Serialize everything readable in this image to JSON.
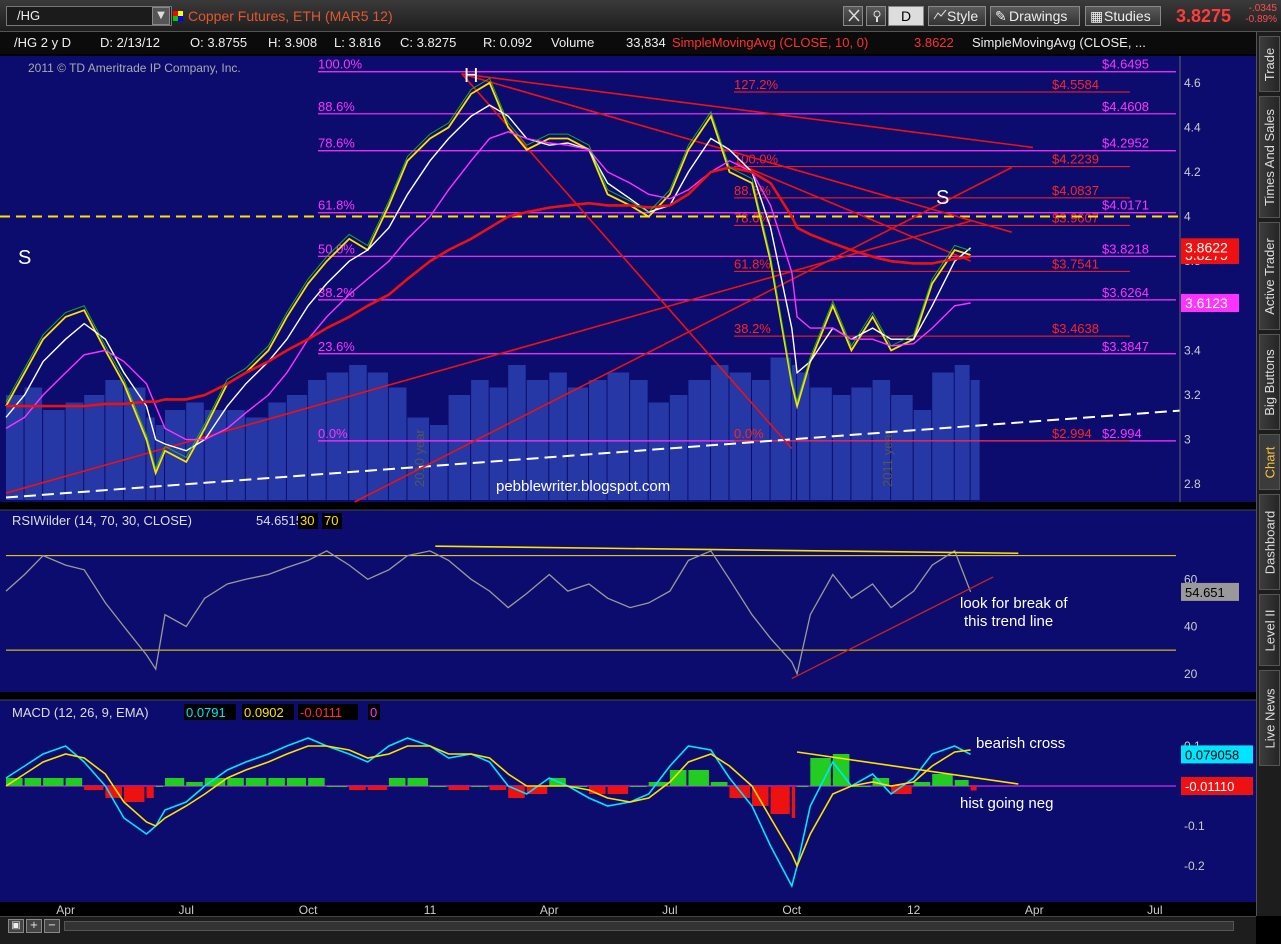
{
  "toolbar": {
    "symbol": "/HG",
    "title": "Copper Futures, ETH (MAR5 12)",
    "timeframe": "D",
    "style_label": "Style",
    "drawings_label": "Drawings",
    "studies_label": "Studies",
    "last_price": "3.8275",
    "change_abs": "-.0345",
    "change_pct": "-0.89%",
    "accent": "#ff3b3b"
  },
  "info_bar": {
    "symbol": "/HG 2 y D",
    "date": "D: 2/13/12",
    "open": "O: 3.8755",
    "high": "H: 3.908",
    "low": "L: 3.816",
    "close": "C: 3.8275",
    "range": "R: 0.092",
    "volume_label": "Volume",
    "volume": "33,834",
    "sma1": "SimpleMovingAvg (CLOSE, 10, 0)",
    "sma1_value": "3.8622",
    "sma2": "SimpleMovingAvg (CLOSE, ..."
  },
  "copyright": "2011 © TD Ameritrade IP Company, Inc.",
  "watermark": "pebblewriter.blogspot.com",
  "sidebar_tabs": [
    "Trade",
    "Times And Sales",
    "Active Trader",
    "Big Buttons",
    "Chart",
    "Dashboard",
    "Level II",
    "Live News"
  ],
  "chart_data": [
    {
      "type": "line",
      "title": "",
      "instrument": "/HG Copper Futures daily (approx.)",
      "x": [
        "2010-02-15",
        "2010-03-01",
        "2010-03-15",
        "2010-04-01",
        "2010-04-15",
        "2010-05-01",
        "2010-05-15",
        "2010-06-01",
        "2010-06-08",
        "2010-06-15",
        "2010-07-01",
        "2010-07-15",
        "2010-08-01",
        "2010-08-15",
        "2010-09-01",
        "2010-09-15",
        "2010-10-01",
        "2010-10-15",
        "2010-11-01",
        "2010-11-15",
        "2010-12-01",
        "2010-12-15",
        "2011-01-01",
        "2011-01-15",
        "2011-02-01",
        "2011-02-15",
        "2011-03-01",
        "2011-03-15",
        "2011-04-01",
        "2011-04-15",
        "2011-05-01",
        "2011-05-15",
        "2011-06-01",
        "2011-06-15",
        "2011-07-01",
        "2011-07-15",
        "2011-08-01",
        "2011-08-15",
        "2011-09-01",
        "2011-09-15",
        "2011-10-01",
        "2011-10-05",
        "2011-10-15",
        "2011-11-01",
        "2011-11-15",
        "2011-12-01",
        "2011-12-15",
        "2012-01-01",
        "2012-01-15",
        "2012-02-01",
        "2012-02-13"
      ],
      "series": [
        {
          "color": "#ffe000",
          "values": [
            3.15,
            3.3,
            3.45,
            3.55,
            3.58,
            3.4,
            3.25,
            3.0,
            2.85,
            2.95,
            2.9,
            3.05,
            3.25,
            3.3,
            3.4,
            3.55,
            3.7,
            3.8,
            3.9,
            3.85,
            4.05,
            4.25,
            4.35,
            4.4,
            4.55,
            4.6,
            4.4,
            4.3,
            4.35,
            4.35,
            4.3,
            4.1,
            4.05,
            4.0,
            4.1,
            4.3,
            4.45,
            4.2,
            4.15,
            3.8,
            3.25,
            3.15,
            3.35,
            3.6,
            3.4,
            3.55,
            3.4,
            3.45,
            3.7,
            3.85,
            3.8275
          ]
        },
        {
          "color": "#ffffff",
          "values": [
            3.1,
            3.2,
            3.35,
            3.45,
            3.52,
            3.45,
            3.3,
            3.15,
            3.0,
            2.98,
            2.95,
            3.0,
            3.15,
            3.25,
            3.35,
            3.45,
            3.6,
            3.7,
            3.8,
            3.85,
            3.95,
            4.1,
            4.25,
            4.35,
            4.45,
            4.5,
            4.45,
            4.35,
            4.32,
            4.33,
            4.3,
            4.15,
            4.08,
            4.02,
            4.05,
            4.2,
            4.35,
            4.3,
            4.2,
            3.95,
            3.5,
            3.3,
            3.35,
            3.5,
            3.45,
            3.5,
            3.45,
            3.45,
            3.6,
            3.8,
            3.86
          ]
        },
        {
          "color": "#ff33ff",
          "values": [
            3.05,
            3.1,
            3.2,
            3.3,
            3.38,
            3.4,
            3.35,
            3.25,
            3.15,
            3.05,
            3.0,
            3.0,
            3.05,
            3.12,
            3.2,
            3.3,
            3.45,
            3.55,
            3.65,
            3.72,
            3.8,
            3.9,
            4.0,
            4.12,
            4.25,
            4.35,
            4.38,
            4.35,
            4.33,
            4.32,
            4.3,
            4.2,
            4.15,
            4.1,
            4.08,
            4.12,
            4.2,
            4.25,
            4.2,
            4.05,
            3.75,
            3.55,
            3.5,
            3.5,
            3.45,
            3.45,
            3.42,
            3.43,
            3.5,
            3.6,
            3.6123
          ]
        },
        {
          "color": "#ee1111",
          "values": [
            3.15,
            3.15,
            3.15,
            3.15,
            3.15,
            3.16,
            3.16,
            3.17,
            3.17,
            3.18,
            3.18,
            3.2,
            3.25,
            3.3,
            3.35,
            3.4,
            3.45,
            3.5,
            3.55,
            3.6,
            3.65,
            3.72,
            3.8,
            3.85,
            3.9,
            3.95,
            4.0,
            4.02,
            4.04,
            4.05,
            4.06,
            4.05,
            4.05,
            4.04,
            4.05,
            4.1,
            4.2,
            4.22,
            4.2,
            4.15,
            4.0,
            3.95,
            3.92,
            3.88,
            3.85,
            3.82,
            3.8,
            3.79,
            3.79,
            3.81,
            3.82
          ]
        }
      ],
      "volume": [
        0.7,
        0.75,
        0.6,
        0.65,
        0.7,
        0.8,
        0.75,
        0.55,
        0.5,
        0.6,
        0.65,
        0.6,
        0.6,
        0.55,
        0.65,
        0.7,
        0.8,
        0.85,
        0.9,
        0.85,
        0.75,
        0.55,
        0.5,
        0.7,
        0.8,
        0.75,
        0.9,
        0.8,
        0.85,
        0.75,
        0.8,
        0.85,
        0.8,
        0.65,
        0.7,
        0.8,
        0.9,
        0.85,
        0.8,
        0.95,
        0.9,
        0.85,
        0.75,
        0.7,
        0.75,
        0.8,
        0.7,
        0.6,
        0.85,
        0.9,
        0.8
      ],
      "ylim": [
        2.72,
        4.72
      ],
      "y_ticks": [
        "4.6",
        "4.4",
        "4.2",
        "4",
        "3.8",
        "3.6",
        "3.4",
        "3.2",
        "3",
        "2.8"
      ],
      "x_ticks": [
        "Apr",
        "Jul",
        "Oct",
        "11",
        "Apr",
        "Jul",
        "Oct",
        "12",
        "Apr",
        "Jul"
      ],
      "x_tick_dates": [
        "2010-04-01",
        "2010-07-01",
        "2010-10-01",
        "2011-01-01",
        "2011-04-01",
        "2011-07-01",
        "2011-10-01",
        "2012-01-01",
        "2012-04-01",
        "2012-07-01"
      ],
      "year_labels": [
        "2010 year",
        "2011 year"
      ],
      "fib_set_1": {
        "color": "#ff33ff",
        "levels": [
          {
            "pct": "100.0%",
            "price": 4.6495,
            "label": "$4.6495"
          },
          {
            "pct": "88.6%",
            "price": 4.4608,
            "label": "$4.4608"
          },
          {
            "pct": "78.6%",
            "price": 4.2952,
            "label": "$4.2952"
          },
          {
            "pct": "61.8%",
            "price": 4.0171,
            "label": "$4.0171"
          },
          {
            "pct": "50.0%",
            "price": 3.8218,
            "label": "$3.8218"
          },
          {
            "pct": "38.2%",
            "price": 3.6264,
            "label": "$3.6264"
          },
          {
            "pct": "23.6%",
            "price": 3.3847,
            "label": "$3.3847"
          },
          {
            "pct": "0.0%",
            "price": 2.994,
            "label": "$2.994"
          }
        ]
      },
      "fib_set_2": {
        "color": "#ff2222",
        "levels": [
          {
            "pct": "127.2%",
            "price": 4.5584,
            "label": "$4.5584"
          },
          {
            "pct": "100.0%",
            "price": 4.2239,
            "label": "$4.2239"
          },
          {
            "pct": "88.6%",
            "price": 4.0837,
            "label": "$4.0837"
          },
          {
            "pct": "78.6%",
            "price": 3.9607,
            "label": "$3.9607"
          },
          {
            "pct": "61.8%",
            "price": 3.7541,
            "label": "$3.7541"
          },
          {
            "pct": "38.2%",
            "price": 3.4638,
            "label": "$3.4638"
          },
          {
            "pct": "0.0%",
            "price": 2.994,
            "label": "$2.994"
          }
        ]
      },
      "pattern_labels": [
        "S",
        "H",
        "S"
      ],
      "price_badges": [
        {
          "label": "3.8275",
          "price": 3.8275,
          "color": "#ee1111"
        },
        {
          "label": "3.8622",
          "price": 3.8622,
          "color": "#ee1111"
        },
        {
          "label": "3.6123",
          "price": 3.6123,
          "color": "#ff33ff"
        }
      ],
      "dashed_yellow_level": 4.0
    },
    {
      "type": "line",
      "title": "RSIWilder (14, 70, 30, CLOSE)",
      "title_value": "54.6515",
      "title_extra": [
        "30",
        "70"
      ],
      "ylim": [
        14,
        80
      ],
      "y_ticks": [
        "60",
        "40",
        "20"
      ],
      "overbought": 70,
      "oversold": 30,
      "values": [
        55,
        62,
        70,
        66,
        64,
        50,
        40,
        28,
        22,
        45,
        40,
        52,
        58,
        60,
        62,
        65,
        68,
        72,
        66,
        60,
        64,
        70,
        72,
        68,
        60,
        55,
        48,
        54,
        62,
        55,
        58,
        52,
        48,
        50,
        55,
        68,
        72,
        60,
        45,
        35,
        25,
        20,
        45,
        62,
        52,
        58,
        48,
        55,
        66,
        72,
        54.65
      ],
      "last_label": "54.651",
      "annotation": [
        "look for break of",
        "this trend line"
      ]
    },
    {
      "type": "line",
      "title": "MACD (12, 26, 9, EMA)",
      "title_values": [
        "0.0791",
        "0.0902",
        "-0.0111",
        "0"
      ],
      "ylim": [
        -0.28,
        0.16
      ],
      "y_ticks": [
        "0.1",
        "0",
        "-0.1",
        "-0.2"
      ],
      "macd": [
        0.02,
        0.05,
        0.08,
        0.1,
        0.06,
        0.0,
        -0.08,
        -0.12,
        -0.1,
        -0.06,
        -0.04,
        0.0,
        0.04,
        0.06,
        0.08,
        0.1,
        0.12,
        0.1,
        0.08,
        0.06,
        0.1,
        0.12,
        0.1,
        0.07,
        0.08,
        0.06,
        0.0,
        -0.02,
        0.02,
        0.0,
        -0.03,
        -0.05,
        -0.04,
        -0.02,
        0.05,
        0.1,
        0.09,
        0.02,
        -0.05,
        -0.15,
        -0.25,
        -0.2,
        -0.05,
        0.06,
        0.0,
        0.03,
        -0.02,
        0.02,
        0.08,
        0.1,
        0.0791
      ],
      "signal": [
        0.0,
        0.03,
        0.06,
        0.08,
        0.07,
        0.03,
        -0.04,
        -0.09,
        -0.1,
        -0.08,
        -0.05,
        -0.02,
        0.02,
        0.04,
        0.06,
        0.08,
        0.1,
        0.1,
        0.09,
        0.07,
        0.08,
        0.1,
        0.1,
        0.08,
        0.08,
        0.07,
        0.03,
        0.0,
        0.0,
        0.0,
        -0.01,
        -0.03,
        -0.04,
        -0.03,
        0.01,
        0.06,
        0.08,
        0.05,
        0.0,
        -0.08,
        -0.17,
        -0.2,
        -0.12,
        -0.02,
        0.0,
        0.01,
        0.0,
        0.01,
        0.05,
        0.085,
        0.0902
      ],
      "hist": [
        0.02,
        0.02,
        0.02,
        0.02,
        -0.01,
        -0.03,
        -0.04,
        -0.03,
        0.0,
        0.02,
        0.01,
        0.02,
        0.02,
        0.02,
        0.02,
        0.02,
        0.02,
        0.0,
        -0.01,
        -0.01,
        0.02,
        0.02,
        0.0,
        -0.01,
        0.0,
        -0.01,
        -0.03,
        -0.02,
        0.02,
        0.0,
        -0.02,
        -0.02,
        0.0,
        0.01,
        0.04,
        0.04,
        0.01,
        -0.03,
        -0.05,
        -0.07,
        -0.08,
        0.0,
        0.07,
        0.08,
        0.0,
        0.02,
        -0.02,
        0.01,
        0.03,
        0.015,
        -0.0111
      ],
      "last_labels": [
        "0.079058",
        "-0.01110"
      ],
      "annotations": [
        "bearish cross",
        "hist going neg"
      ]
    }
  ]
}
